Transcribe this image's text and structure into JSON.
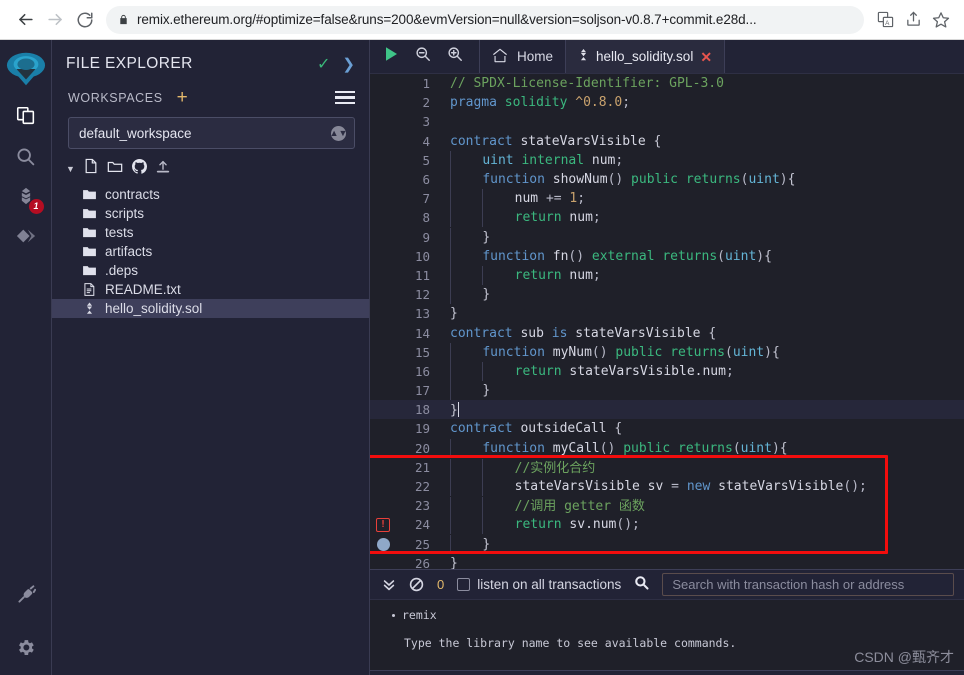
{
  "browser": {
    "back_icon": "arrow-left-icon",
    "forward_icon": "arrow-right-icon",
    "reload_icon": "reload-icon",
    "lock_icon": "lock-icon",
    "url": "remix.ethereum.org/#optimize=false&runs=200&evmVersion=null&version=soljson-v0.8.7+commit.e28d...",
    "actions": [
      {
        "name": "translate-icon",
        "glyph": "translate"
      },
      {
        "name": "share-icon",
        "glyph": "share"
      },
      {
        "name": "bookmark-star-icon",
        "glyph": "star"
      }
    ]
  },
  "rail": {
    "logo_name": "remix-logo",
    "items": [
      {
        "name": "file-explorer-icon",
        "label": "File explorers",
        "badge": null,
        "active": true
      },
      {
        "name": "search-icon",
        "label": "Search in files",
        "badge": null,
        "active": false
      },
      {
        "name": "solidity-compiler-icon",
        "label": "Solidity compiler",
        "badge": "1",
        "active": false
      },
      {
        "name": "deploy-run-icon",
        "label": "Deploy & run transactions",
        "badge": null,
        "active": false
      }
    ],
    "bottom": [
      {
        "name": "plugin-manager-icon",
        "label": "Plugin manager"
      },
      {
        "name": "settings-gear-icon",
        "label": "Settings"
      }
    ]
  },
  "explorer": {
    "title": "FILE EXPLORER",
    "check_icon": "checkmark-icon",
    "chevron_icon": "chevron-right-icon",
    "workspaces_label": "WORKSPACES",
    "add_workspace_label": "+",
    "menu_icon": "hamburger-menu-icon",
    "workspace_selected": "default_workspace",
    "tree_actions": [
      {
        "name": "collapse-caret-icon",
        "glyph": "caret-down"
      },
      {
        "name": "new-file-icon",
        "glyph": "file"
      },
      {
        "name": "new-folder-icon",
        "glyph": "folder"
      },
      {
        "name": "github-clone-icon",
        "glyph": "github"
      },
      {
        "name": "upload-file-icon",
        "glyph": "upload"
      }
    ],
    "files": [
      {
        "name": "contracts",
        "type": "folder",
        "selected": false
      },
      {
        "name": "scripts",
        "type": "folder",
        "selected": false
      },
      {
        "name": "tests",
        "type": "folder",
        "selected": false
      },
      {
        "name": "artifacts",
        "type": "folder",
        "selected": false
      },
      {
        "name": ".deps",
        "type": "folder",
        "selected": false
      },
      {
        "name": "README.txt",
        "type": "file",
        "selected": false
      },
      {
        "name": "hello_solidity.sol",
        "type": "solidity",
        "selected": true
      }
    ]
  },
  "tabbar": {
    "run_icon": "run-play-icon",
    "zoom_out_icon": "zoom-out-icon",
    "zoom_in_icon": "zoom-in-icon",
    "home_icon": "home-icon",
    "home_label": "Home",
    "active_tab_icon": "solidity-file-icon",
    "active_tab_label": "hello_solidity.sol",
    "close_label": "✕"
  },
  "editor": {
    "cursor_line": 18,
    "error_line": 24,
    "breakpoint_line": 25,
    "annotation_box": {
      "from_line": 21,
      "to_line": 25,
      "color": "#f20d0d"
    },
    "lines": [
      {
        "n": 1,
        "indent": 0,
        "tokens": [
          {
            "t": "com",
            "s": "// SPDX-License-Identifier: GPL-3.0"
          }
        ]
      },
      {
        "n": 2,
        "indent": 0,
        "tokens": [
          {
            "t": "key",
            "s": "pragma"
          },
          {
            "t": "id",
            "s": " "
          },
          {
            "t": "mod",
            "s": "solidity"
          },
          {
            "t": "id",
            "s": " "
          },
          {
            "t": "num",
            "s": "^0.8.0"
          },
          {
            "t": "punc",
            "s": ";"
          }
        ]
      },
      {
        "n": 3,
        "indent": 0,
        "tokens": []
      },
      {
        "n": 4,
        "indent": 0,
        "tokens": [
          {
            "t": "key",
            "s": "contract"
          },
          {
            "t": "id",
            "s": " stateVarsVisible "
          },
          {
            "t": "brace",
            "s": "{"
          }
        ]
      },
      {
        "n": 5,
        "indent": 1,
        "tokens": [
          {
            "t": "type",
            "s": "uint"
          },
          {
            "t": "id",
            "s": " "
          },
          {
            "t": "mod",
            "s": "internal"
          },
          {
            "t": "id",
            "s": " num"
          },
          {
            "t": "punc",
            "s": ";"
          }
        ]
      },
      {
        "n": 6,
        "indent": 1,
        "tokens": [
          {
            "t": "key",
            "s": "function"
          },
          {
            "t": "fn",
            "s": " showNum"
          },
          {
            "t": "punc",
            "s": "() "
          },
          {
            "t": "mod",
            "s": "public"
          },
          {
            "t": "id",
            "s": " "
          },
          {
            "t": "mod",
            "s": "returns"
          },
          {
            "t": "punc",
            "s": "("
          },
          {
            "t": "type",
            "s": "uint"
          },
          {
            "t": "punc",
            "s": ")"
          },
          {
            "t": "brace",
            "s": "{"
          }
        ]
      },
      {
        "n": 7,
        "indent": 2,
        "tokens": [
          {
            "t": "id",
            "s": "num "
          },
          {
            "t": "punc",
            "s": "+= "
          },
          {
            "t": "num",
            "s": "1"
          },
          {
            "t": "punc",
            "s": ";"
          }
        ]
      },
      {
        "n": 8,
        "indent": 2,
        "tokens": [
          {
            "t": "mod",
            "s": "return"
          },
          {
            "t": "id",
            "s": " num"
          },
          {
            "t": "punc",
            "s": ";"
          }
        ]
      },
      {
        "n": 9,
        "indent": 1,
        "tokens": [
          {
            "t": "brace",
            "s": "}"
          }
        ]
      },
      {
        "n": 10,
        "indent": 1,
        "tokens": [
          {
            "t": "key",
            "s": "function"
          },
          {
            "t": "fn",
            "s": " fn"
          },
          {
            "t": "punc",
            "s": "() "
          },
          {
            "t": "mod",
            "s": "external"
          },
          {
            "t": "id",
            "s": " "
          },
          {
            "t": "mod",
            "s": "returns"
          },
          {
            "t": "punc",
            "s": "("
          },
          {
            "t": "type",
            "s": "uint"
          },
          {
            "t": "punc",
            "s": ")"
          },
          {
            "t": "brace",
            "s": "{"
          }
        ]
      },
      {
        "n": 11,
        "indent": 2,
        "tokens": [
          {
            "t": "mod",
            "s": "return"
          },
          {
            "t": "id",
            "s": " num"
          },
          {
            "t": "punc",
            "s": ";"
          }
        ]
      },
      {
        "n": 12,
        "indent": 1,
        "tokens": [
          {
            "t": "brace",
            "s": "}"
          }
        ]
      },
      {
        "n": 13,
        "indent": 0,
        "tokens": [
          {
            "t": "brace",
            "s": "}"
          }
        ]
      },
      {
        "n": 14,
        "indent": 0,
        "tokens": [
          {
            "t": "key",
            "s": "contract"
          },
          {
            "t": "id",
            "s": " sub "
          },
          {
            "t": "key",
            "s": "is"
          },
          {
            "t": "id",
            "s": " stateVarsVisible "
          },
          {
            "t": "brace",
            "s": "{"
          }
        ]
      },
      {
        "n": 15,
        "indent": 1,
        "tokens": [
          {
            "t": "key",
            "s": "function"
          },
          {
            "t": "fn",
            "s": " myNum"
          },
          {
            "t": "punc",
            "s": "() "
          },
          {
            "t": "mod",
            "s": "public"
          },
          {
            "t": "id",
            "s": " "
          },
          {
            "t": "mod",
            "s": "returns"
          },
          {
            "t": "punc",
            "s": "("
          },
          {
            "t": "type",
            "s": "uint"
          },
          {
            "t": "punc",
            "s": ")"
          },
          {
            "t": "brace",
            "s": "{"
          }
        ]
      },
      {
        "n": 16,
        "indent": 2,
        "tokens": [
          {
            "t": "mod",
            "s": "return"
          },
          {
            "t": "id",
            "s": " stateVarsVisible.num"
          },
          {
            "t": "punc",
            "s": ";"
          }
        ]
      },
      {
        "n": 17,
        "indent": 1,
        "tokens": [
          {
            "t": "brace",
            "s": "}"
          }
        ]
      },
      {
        "n": 18,
        "indent": 0,
        "tokens": [
          {
            "t": "brace",
            "s": "}"
          }
        ]
      },
      {
        "n": 19,
        "indent": 0,
        "tokens": [
          {
            "t": "key",
            "s": "contract"
          },
          {
            "t": "id",
            "s": " outsideCall "
          },
          {
            "t": "brace",
            "s": "{"
          }
        ]
      },
      {
        "n": 20,
        "indent": 1,
        "tokens": [
          {
            "t": "key",
            "s": "function"
          },
          {
            "t": "fn",
            "s": " myCall"
          },
          {
            "t": "punc",
            "s": "() "
          },
          {
            "t": "mod",
            "s": "public"
          },
          {
            "t": "id",
            "s": " "
          },
          {
            "t": "mod",
            "s": "returns"
          },
          {
            "t": "punc",
            "s": "("
          },
          {
            "t": "type",
            "s": "uint"
          },
          {
            "t": "punc",
            "s": ")"
          },
          {
            "t": "brace",
            "s": "{"
          }
        ]
      },
      {
        "n": 21,
        "indent": 2,
        "tokens": [
          {
            "t": "com",
            "s": "//实例化合约"
          }
        ]
      },
      {
        "n": 22,
        "indent": 2,
        "tokens": [
          {
            "t": "id",
            "s": "stateVarsVisible sv "
          },
          {
            "t": "punc",
            "s": "= "
          },
          {
            "t": "key",
            "s": "new"
          },
          {
            "t": "id",
            "s": " stateVarsVisible"
          },
          {
            "t": "punc",
            "s": "();"
          }
        ]
      },
      {
        "n": 23,
        "indent": 2,
        "tokens": [
          {
            "t": "com",
            "s": "//调用 getter 函数"
          }
        ]
      },
      {
        "n": 24,
        "indent": 2,
        "tokens": [
          {
            "t": "mod",
            "s": "return"
          },
          {
            "t": "id",
            "s": " sv.num"
          },
          {
            "t": "punc",
            "s": "();"
          }
        ]
      },
      {
        "n": 25,
        "indent": 1,
        "tokens": [
          {
            "t": "brace",
            "s": "}"
          }
        ]
      },
      {
        "n": 26,
        "indent": 0,
        "tokens": [
          {
            "t": "brace",
            "s": "}"
          }
        ]
      }
    ]
  },
  "terminal": {
    "collapse_icon": "double-chevron-down-icon",
    "clear_icon": "ban-clear-icon",
    "pending_count": "0",
    "listen_label": "listen on all transactions",
    "listen_checked": false,
    "search_icon": "search-icon",
    "search_placeholder": "Search with transaction hash or address",
    "log_title": "remix",
    "log_hint": "Type the library name to see available commands.",
    "watermark": "CSDN @甄齐才"
  }
}
